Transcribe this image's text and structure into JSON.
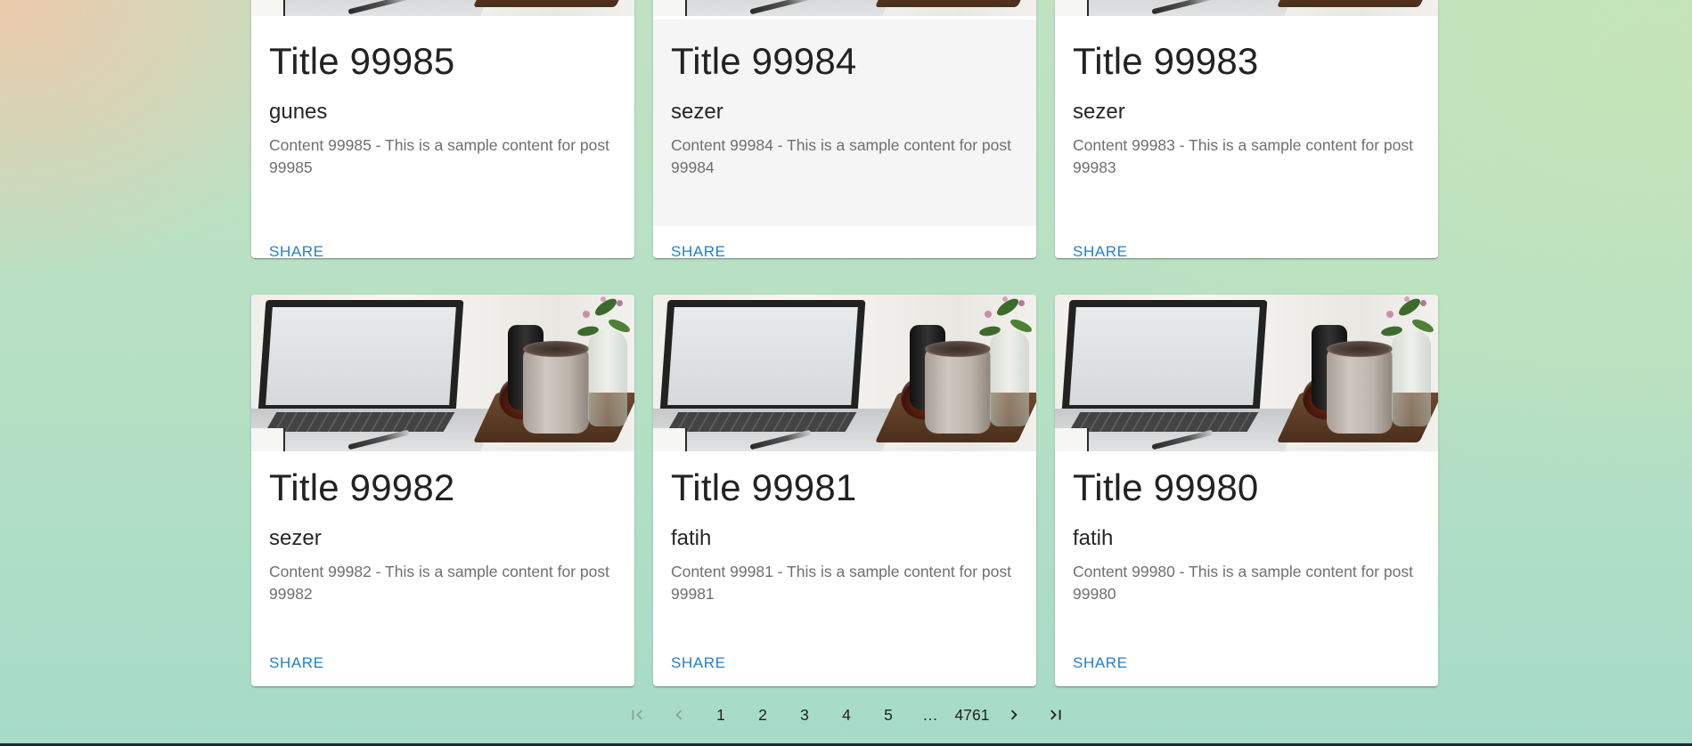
{
  "posts": [
    {
      "title": "Title 99985",
      "author": "gunes",
      "content": "Content 99985 - This is a sample content for post 99985",
      "share_label": "SHARE"
    },
    {
      "title": "Title 99984",
      "author": "sezer",
      "content": "Content 99984 - This is a sample content for post 99984",
      "share_label": "SHARE"
    },
    {
      "title": "Title 99983",
      "author": "sezer",
      "content": "Content 99983 - This is a sample content for post 99983",
      "share_label": "SHARE"
    },
    {
      "title": "Title 99982",
      "author": "sezer",
      "content": "Content 99982 - This is a sample content for post 99982",
      "share_label": "SHARE"
    },
    {
      "title": "Title 99981",
      "author": "fatih",
      "content": "Content 99981 - This is a sample content for post 99981",
      "share_label": "SHARE"
    },
    {
      "title": "Title 99980",
      "author": "fatih",
      "content": "Content 99980 - This is a sample content for post 99980",
      "share_label": "SHARE"
    }
  ],
  "pagination": {
    "first_icon": "first-page-icon",
    "prev_icon": "chevron-left-icon",
    "pages": [
      "1",
      "2",
      "3",
      "4",
      "5"
    ],
    "ellipsis": "…",
    "last_page": "4761",
    "next_icon": "chevron-right-icon",
    "last_icon": "last-page-icon"
  },
  "colors": {
    "share_link": "#1f7fd0",
    "hover_bg": "#f5f5f5"
  }
}
